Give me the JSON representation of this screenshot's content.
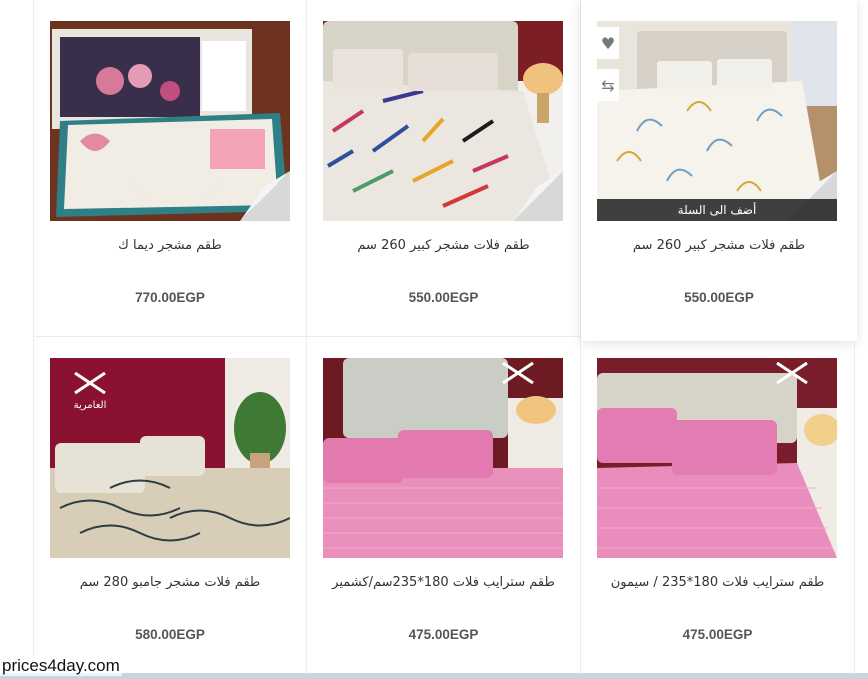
{
  "products": [
    {
      "title": "طقم مشجر ديما ك",
      "price": "770.00EGP"
    },
    {
      "title": "طقم فلات مشجر كبير 260 سم",
      "price": "550.00EGP"
    },
    {
      "title": "طقم فلات مشجر كبير 260 سم",
      "price": "550.00EGP",
      "add_to_cart": "أضف الى السلة"
    },
    {
      "title": "طقم فلات مشجر جامبو 280 سم",
      "price": "580.00EGP"
    },
    {
      "title": "طقم سترايب فلات 180*235سم/كشمير",
      "price": "475.00EGP"
    },
    {
      "title": "طقم سترايب فلات 180*235 / سيمون",
      "price": "475.00EGP"
    }
  ],
  "brand_text": "العامرية",
  "icons": {
    "wishlist": "heart-icon",
    "compare": "compare-arrows-icon"
  },
  "watermark": "prices4day.com"
}
